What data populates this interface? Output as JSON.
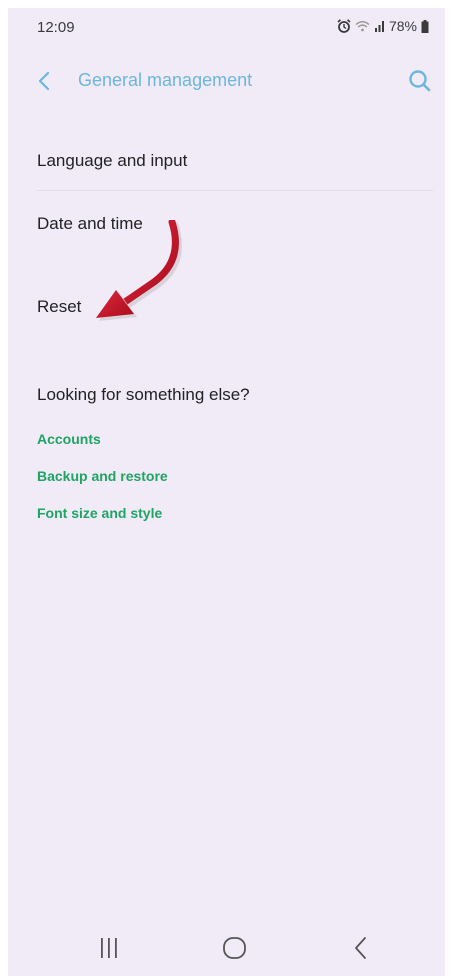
{
  "status_bar": {
    "time": "12:09",
    "battery": "78%",
    "icons": [
      "alarm-icon",
      "wifi-icon",
      "signal-icon",
      "battery-icon"
    ]
  },
  "app_bar": {
    "title": "General management",
    "back_icon": "chevron-left-icon",
    "search_icon": "search-icon"
  },
  "menu": {
    "items": [
      {
        "label": "Language and input"
      },
      {
        "label": "Date and time"
      },
      {
        "label": "Reset"
      }
    ]
  },
  "suggestions": {
    "heading": "Looking for something else?",
    "links": [
      {
        "label": "Accounts"
      },
      {
        "label": "Backup and restore"
      },
      {
        "label": "Font size and style"
      }
    ]
  },
  "nav_bar": {
    "icons": [
      "recent-apps-icon",
      "home-icon",
      "back-icon"
    ]
  },
  "colors": {
    "background": "#f0ebf7",
    "title_blue": "#6cb6df",
    "link_green": "#1fa463",
    "annotation_arrow": "#c8102e"
  }
}
